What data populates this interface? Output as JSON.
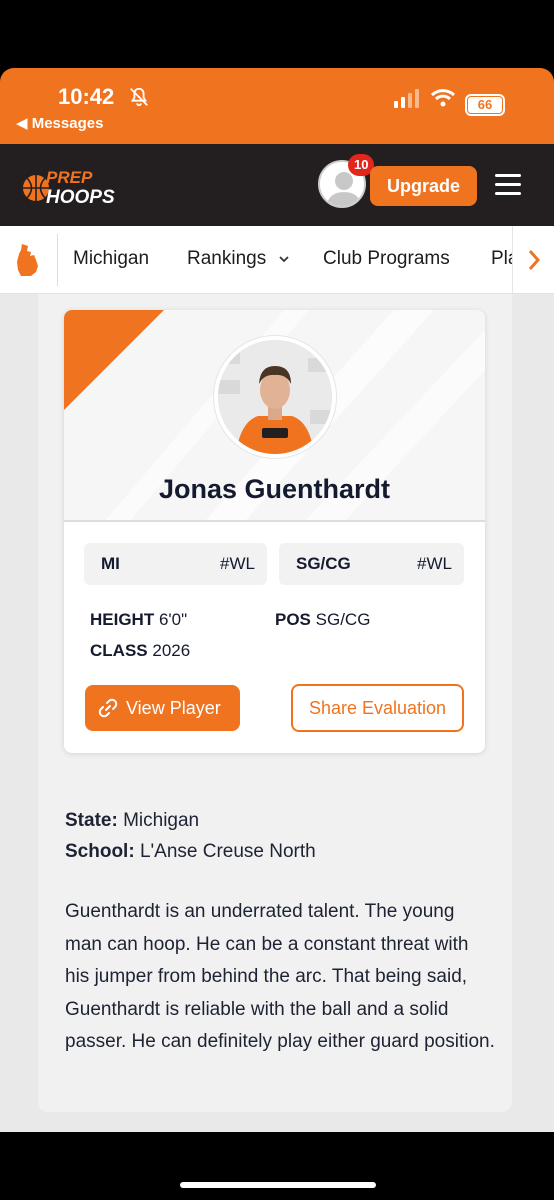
{
  "status_bar": {
    "time": "10:42",
    "back_label": "◀ Messages",
    "battery": "66",
    "icons": [
      "bell-slash-icon",
      "signal-icon",
      "wifi-icon",
      "battery-icon"
    ]
  },
  "header": {
    "logo_line1": "PREP",
    "logo_line2": "HOOPS",
    "notification_count": "10",
    "upgrade_label": "Upgrade",
    "colors": {
      "brand_orange": "#f0731f",
      "header_dark": "#231f20",
      "badge_red": "#e2261c"
    }
  },
  "subnav": {
    "items": [
      "Michigan",
      "Rankings",
      "Club Programs",
      "Pla"
    ]
  },
  "player": {
    "name": "Jonas Guenthardt",
    "state_pill": {
      "label": "MI",
      "rank": "#WL"
    },
    "position_pill": {
      "label": "SG/CG",
      "rank": "#WL"
    },
    "height_label": "HEIGHT",
    "height_value": "6'0\"",
    "class_label": "CLASS",
    "class_value": "2026",
    "pos_label": "POS",
    "pos_value": "SG/CG",
    "view_button": "View Player",
    "share_button": "Share Evaluation"
  },
  "details": {
    "state_label": "State:",
    "state_value": "Michigan",
    "school_label": "School:",
    "school_value": "L'Anse Creuse North",
    "evaluation": "Guenthardt is an underrated talent. The young man can hoop. He can be a constant threat with his jumper from behind the arc. That being said, Guenthardt is reliable with the ball and a solid passer. He can definitely play either guard position."
  }
}
